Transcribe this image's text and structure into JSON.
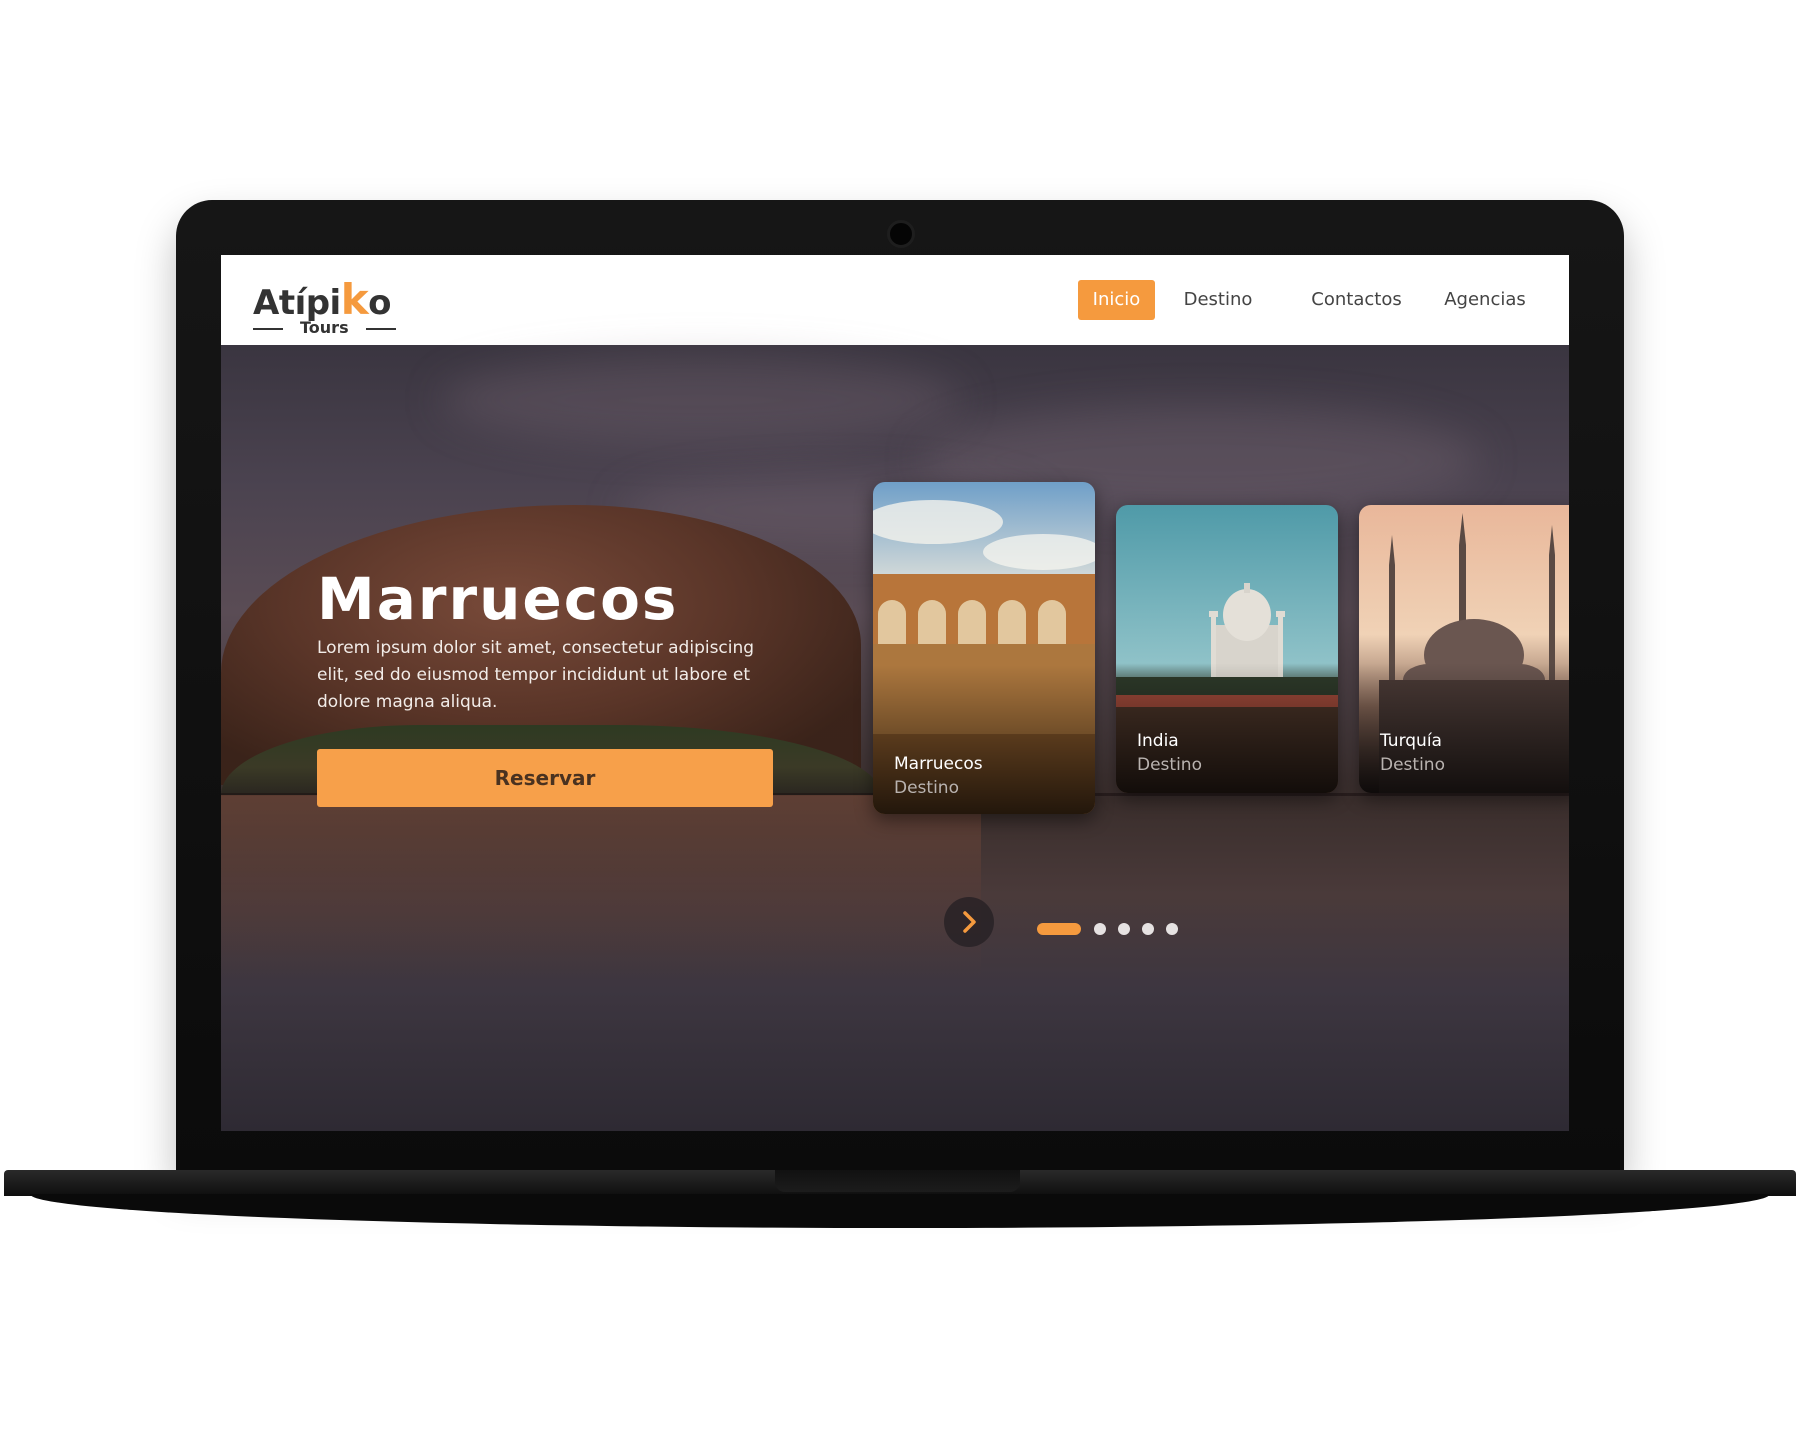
{
  "brand": {
    "name_prefix": "Atípi",
    "name_k": "k",
    "name_suffix": "o",
    "tagline": "Tours"
  },
  "nav": {
    "items": [
      {
        "label": "Inicio",
        "active": true
      },
      {
        "label": "Destino",
        "active": false
      },
      {
        "label": "Contactos",
        "active": false
      },
      {
        "label": "Agencias",
        "active": false
      }
    ]
  },
  "hero": {
    "title": "Marruecos",
    "description": "Lorem ipsum dolor sit amet, consectetur adipiscing elit, sed do eiusmod tempor incididunt ut labore et dolore magna aliqua.",
    "button_label": "Reservar"
  },
  "cards": [
    {
      "title": "Marruecos",
      "subtitle": "Destino",
      "active": true
    },
    {
      "title": "India",
      "subtitle": "Destino",
      "active": false
    },
    {
      "title": "Turquía",
      "subtitle": "Destino",
      "active": false
    }
  ],
  "carousel": {
    "next_icon": "chevron-right-icon",
    "total_slides": 5,
    "active_slide": 1
  },
  "colors": {
    "accent": "#f59a3e",
    "button": "#f7a04a",
    "nav_text": "#444444"
  }
}
